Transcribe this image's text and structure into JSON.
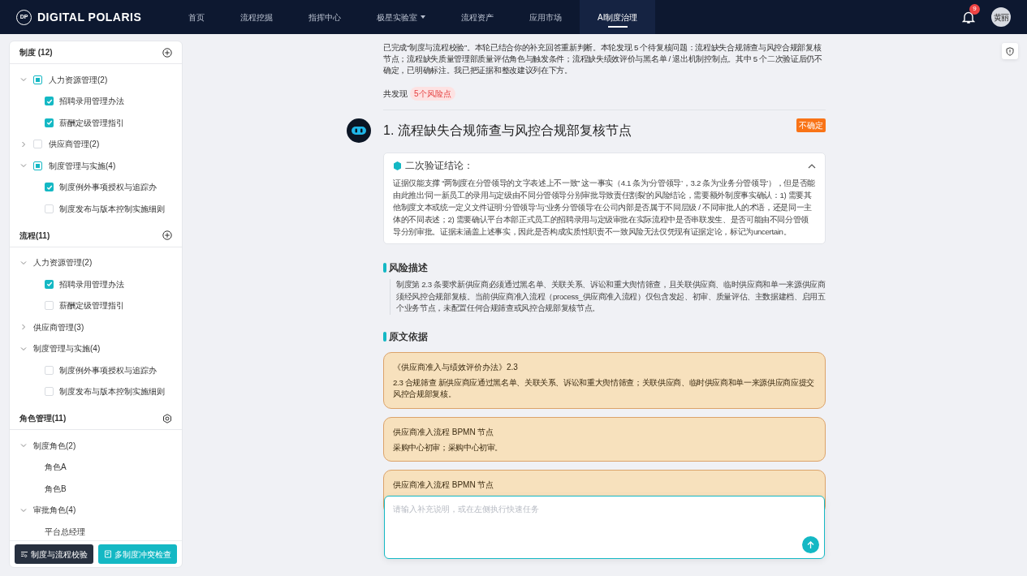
{
  "header": {
    "logo_mark": "DP",
    "brand": "DIGITAL POLARIS",
    "nav": [
      {
        "label": "首页",
        "selected": false,
        "dropdown": false
      },
      {
        "label": "流程挖掘",
        "selected": false,
        "dropdown": false
      },
      {
        "label": "指挥中心",
        "selected": false,
        "dropdown": false
      },
      {
        "label": "极星实验室",
        "selected": false,
        "dropdown": true
      },
      {
        "label": "流程资产",
        "selected": false,
        "dropdown": false
      },
      {
        "label": "应用市场",
        "selected": false,
        "dropdown": false
      },
      {
        "label": "AI制度治理",
        "selected": true,
        "dropdown": false
      }
    ],
    "notifications": {
      "count": "9"
    },
    "user": {
      "avatar_text": "黄丽"
    }
  },
  "sidebar": {
    "sections": [
      {
        "title": "制度 (12)",
        "kind": "add",
        "groups": [
          {
            "label": "人力资源管理(2)",
            "expanded": true,
            "checked": false,
            "indeterminate": true,
            "children": [
              {
                "label": "招聘录用管理办法",
                "checked": true
              },
              {
                "label": "薪酬定级管理指引",
                "checked": true
              }
            ]
          },
          {
            "label": "供应商管理(2)",
            "expanded": false,
            "checked": false,
            "indeterminate": false
          },
          {
            "label": "制度管理与实施(4)",
            "expanded": true,
            "checked": false,
            "indeterminate": true,
            "children": [
              {
                "label": "制度例外事项授权与追踪办",
                "checked": true
              },
              {
                "label": "制度发布与版本控制实施细则",
                "checked": false
              }
            ]
          }
        ]
      },
      {
        "title": "流程(11)",
        "kind": "add",
        "groups": [
          {
            "label": "人力资源管理(2)",
            "expanded": true,
            "children": [
              {
                "label": "招聘录用管理办法",
                "checked": true
              },
              {
                "label": "薪酬定级管理指引",
                "checked": false
              }
            ]
          },
          {
            "label": "供应商管理(3)",
            "expanded": false
          },
          {
            "label": "制度管理与实施(4)",
            "expanded": true,
            "children": [
              {
                "label": "制度例外事项授权与追踪办",
                "checked": false
              },
              {
                "label": "制度发布与版本控制实施细则",
                "checked": false
              }
            ]
          }
        ]
      },
      {
        "title": "角色管理(11)",
        "kind": "settings",
        "groups": [
          {
            "label": "制度角色(2)",
            "expanded": true,
            "children": [
              {
                "label": "角色A"
              },
              {
                "label": "角色B"
              }
            ]
          },
          {
            "label": "审批角色(4)",
            "expanded": true,
            "children": [
              {
                "label": "平台总经理"
              }
            ]
          }
        ]
      }
    ],
    "buttons": [
      {
        "label": "制度与流程校验",
        "kind": "dark"
      },
      {
        "label": "多制度冲突检查",
        "kind": "teal"
      }
    ]
  },
  "report": {
    "summary": "已完成“制度与流程校验”。本轮已结合你的补充回答重新判断。本轮发现 5 个待复核问题：流程缺失合规筛查与风控合规部复核节点；流程缺失质量管理部质量评估角色与触发条件；流程缺失绩效评价与黑名单 / 退出机制控制点。其中 5 个二次验证后仍不确定，已明确标注。我已把证据和整改建议列在下方。",
    "found_label": "共发现",
    "found_badge": "5个风险点",
    "risk": {
      "title": "1. 流程缺失合规筛查与风控合规部复核节点",
      "status": "不确定",
      "verification": {
        "title": "二次验证结论：",
        "expanded": true,
        "text": "证据仅能支撑 “两制度在分管领导的文字表述上不一致” 这一事实（4.1 条为‘分管领导’，3.2 条为‘业务分管领导’），但是否能由此推出‘同一新员工的录用与定级由不同分管领导分别审批导致责任割裂’的风险结论，需要额外制度事实确认：1) 需要其他制度文本或统一定义文件证明‘分管领导’与‘业务分管领导’在公司内部是否属于不同层级 / 不同审批人的术语，还是同一主体的不同表述；2) 需要确认平台本部正式员工的招聘录用与定级审批在实际流程中是否串联发生、是否可能由不同分管领导分别审批。证据未涵盖上述事实，因此是否构成实质性职责不一致风险无法仅凭现有证据定论，标记为uncertain。"
      },
      "description": {
        "heading": "风险描述",
        "text": "制度第 2.3 条要求新供应商必须通过黑名单、关联关系、诉讼和重大舆情筛查，且关联供应商、临时供应商和单一来源供应商须经风控合规部复核。当前供应商准入流程（process_供应商准入流程）仅包含发起、初审、质量评估、主数据建档、启用五个业务节点，未配置任何合规筛查或风控合规部复核节点。"
      },
      "evidence": {
        "heading": "原文依据",
        "items": [
          {
            "title": "《供应商准入与绩效评价办法》2.3",
            "text": "2.3 合规筛查 新供应商应通过黑名单、关联关系、诉讼和重大舆情筛查；关联供应商、临时供应商和单一来源供应商应提交风控合规部复核。"
          },
          {
            "title": "供应商准入流程 BPMN 节点",
            "text": "采购中心初审；采购中心初审。"
          },
          {
            "title": "供应商准入流程 BPMN 节点"
          }
        ]
      }
    }
  },
  "composer": {
    "placeholder": "请输入补充说明，或在左侧执行快速任务"
  }
}
